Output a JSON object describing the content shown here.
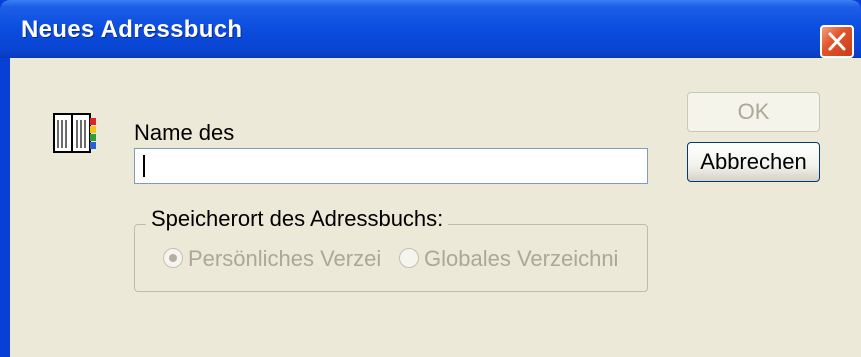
{
  "window": {
    "title": "Neues Adressbuch"
  },
  "form": {
    "name_label": "Name des",
    "name_value": "",
    "location_group_label": "Speicherort des Adressbuchs:",
    "options": [
      {
        "label": "Persönliches Verzei",
        "selected": true,
        "enabled": false
      },
      {
        "label": "Globales Verzeichni",
        "selected": false,
        "enabled": false
      }
    ]
  },
  "buttons": {
    "ok_label": "OK",
    "ok_enabled": false,
    "cancel_label": "Abbrechen"
  },
  "icons": {
    "close": "close-icon",
    "address_book": "address-book-icon"
  },
  "colors": {
    "titlebar": "#0a4ddf",
    "client_bg": "#ece9d8",
    "close_button": "#e2562e",
    "disabled_text": "#aca899"
  }
}
